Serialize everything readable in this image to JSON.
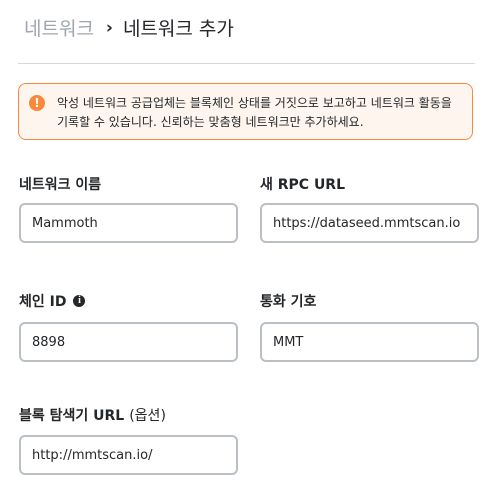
{
  "breadcrumb": {
    "parent": "네트워크",
    "separator": "›",
    "current": "네트워크 추가"
  },
  "warning": {
    "icon": "warning-exclamation-icon",
    "icon_glyph": "!",
    "text": "악성 네트워크 공급업체는 블록체인 상태를 거짓으로 보고하고 네트워크 활동을 기록할 수 있습니다. 신뢰하는 맞춤형 네트워크만 추가하세요.",
    "accent_color": "#f8883b",
    "background_color": "#fef5ef"
  },
  "fields": {
    "network_name": {
      "label": "네트워크 이름",
      "value": "Mammoth"
    },
    "rpc_url": {
      "label": "새 RPC URL",
      "value": "https://dataseed.mmtscan.io"
    },
    "chain_id": {
      "label": "체인 ID",
      "info_icon": "i",
      "value": "8898"
    },
    "currency_symbol": {
      "label": "통화 기호",
      "value": "MMT"
    },
    "block_explorer": {
      "label": "블록 탐색기 URL",
      "optional": "(옵션)",
      "value": "http://mmtscan.io/"
    }
  }
}
